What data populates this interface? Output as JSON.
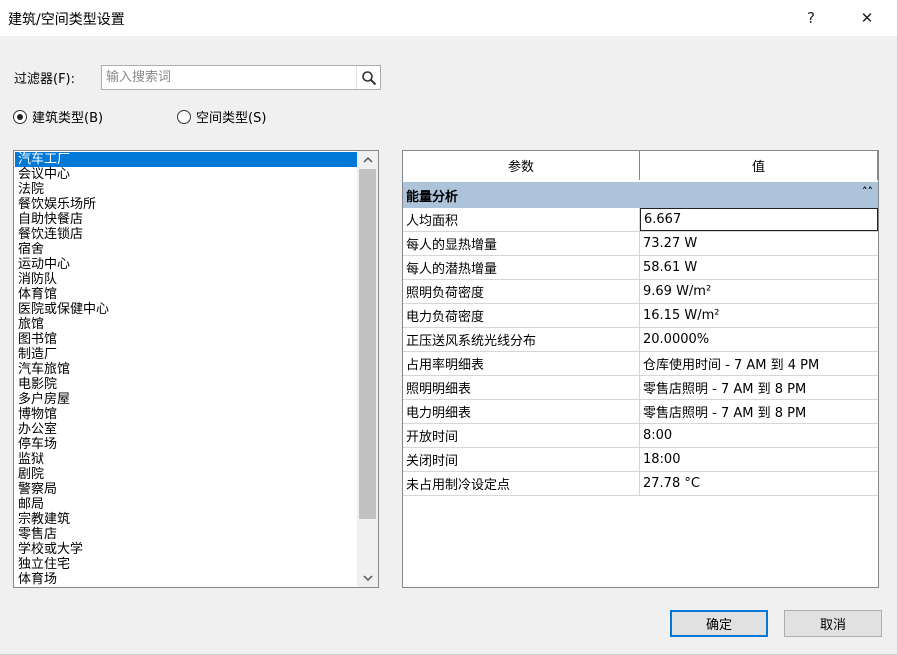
{
  "window": {
    "title": "建筑/空间类型设置",
    "help_label": "?",
    "close_label": "✕"
  },
  "filter": {
    "label": "过滤器(F):",
    "placeholder": "输入搜索词",
    "value": "",
    "search_icon": "magnifier-icon"
  },
  "radio": {
    "building_label": "建筑类型(B)",
    "building_checked": true,
    "space_label": "空间类型(S)",
    "space_checked": false
  },
  "type_list": {
    "items": [
      "汽车工厂",
      "会议中心",
      "法院",
      "餐饮娱乐场所",
      "自助快餐店",
      "餐饮连锁店",
      "宿舍",
      "运动中心",
      "消防队",
      "体育馆",
      "医院或保健中心",
      "旅馆",
      "图书馆",
      "制造厂",
      "汽车旅馆",
      "电影院",
      "多户房屋",
      "博物馆",
      "办公室",
      "停车场",
      "监狱",
      "剧院",
      "警察局",
      "邮局",
      "宗教建筑",
      "零售店",
      "学校或大学",
      "独立住宅",
      "体育场"
    ],
    "selected_index": 0
  },
  "param_table": {
    "col_param": "参数",
    "col_value": "值",
    "group_label": "能量分析",
    "collapse_icon": "double-chevron-up-icon",
    "rows": [
      {
        "name": "人均面积",
        "value": "6.667"
      },
      {
        "name": "每人的显热增量",
        "value": "73.27 W"
      },
      {
        "name": "每人的潜热增量",
        "value": "58.61 W"
      },
      {
        "name": "照明负荷密度",
        "value": "9.69 W/m²"
      },
      {
        "name": "电力负荷密度",
        "value": "16.15 W/m²"
      },
      {
        "name": "正压送风系统光线分布",
        "value": "20.0000%"
      },
      {
        "name": "占用率明细表",
        "value": "仓库使用时间 - 7 AM 到 4 PM"
      },
      {
        "name": "照明明细表",
        "value": "零售店照明 - 7 AM 到 8 PM"
      },
      {
        "name": "电力明细表",
        "value": "零售店照明 - 7 AM 到 8 PM"
      },
      {
        "name": "开放时间",
        "value": "8:00"
      },
      {
        "name": "关闭时间",
        "value": "18:00"
      },
      {
        "name": "未占用制冷设定点",
        "value": "27.78 °C"
      }
    ]
  },
  "buttons": {
    "ok": "确定",
    "cancel": "取消"
  },
  "colors": {
    "selection": "#0078d7",
    "group_header": "#acc3da"
  }
}
